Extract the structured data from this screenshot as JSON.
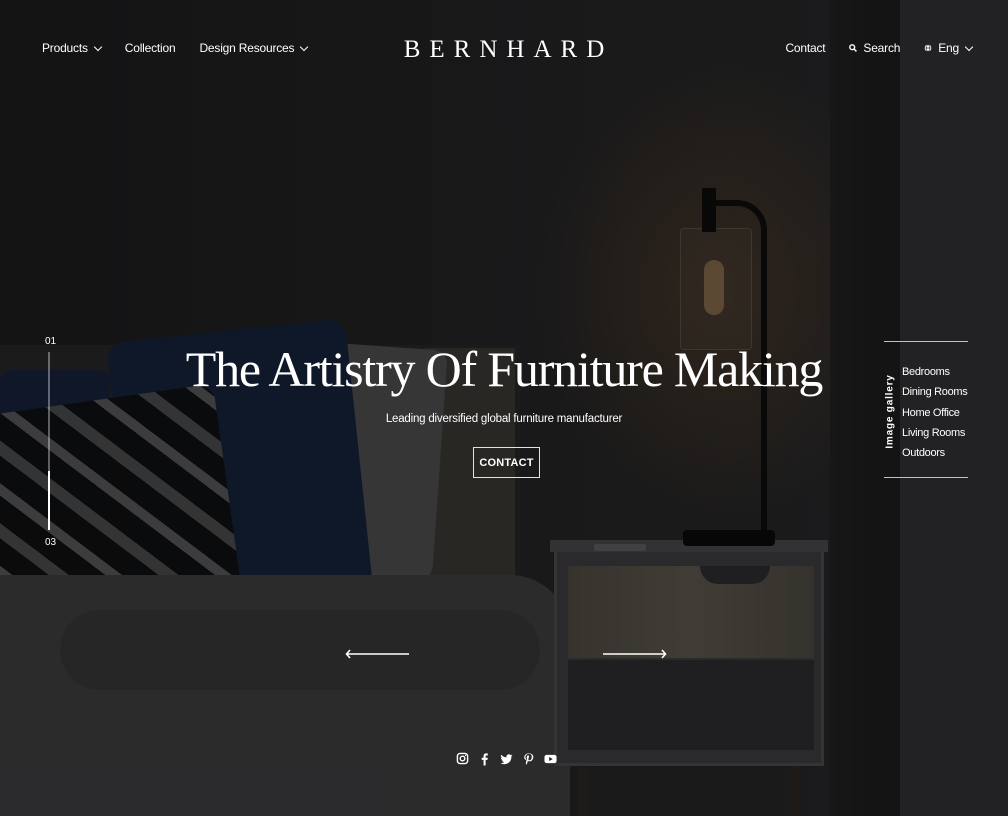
{
  "header": {
    "nav_left": [
      {
        "label": "Products",
        "has_dropdown": true
      },
      {
        "label": "Collection",
        "has_dropdown": false
      },
      {
        "label": "Design Resources",
        "has_dropdown": true
      }
    ],
    "logo": "BERNHARD",
    "contact_label": "Contact",
    "search_label": "Search",
    "language_label": "Eng"
  },
  "slider": {
    "current": "01",
    "total": "03",
    "progress": 0.33
  },
  "hero": {
    "title": "The Artistry Of Furniture Making",
    "subtitle": "Leading diversified global furniture manufacturer",
    "cta_label": "CONTACT"
  },
  "gallery": {
    "heading": "Image gallery",
    "items": [
      "Bedrooms",
      "Dining Rooms",
      "Home Office",
      "Living Rooms",
      "Outdoors"
    ]
  },
  "social": [
    "instagram-icon",
    "facebook-icon",
    "twitter-icon",
    "pinterest-icon",
    "youtube-icon"
  ],
  "colors": {
    "accent_line": "#c9c2a6",
    "text": "#ffffff",
    "button_border": "#e6e2d6"
  }
}
